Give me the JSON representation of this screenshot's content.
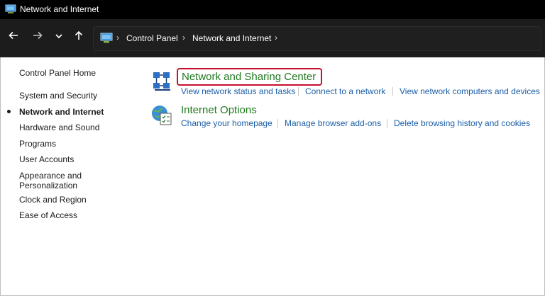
{
  "window": {
    "title": "Network and Internet"
  },
  "address_bar": {
    "breadcrumbs": [
      "Control Panel",
      "Network and Internet"
    ]
  },
  "sidebar": {
    "home": "Control Panel Home",
    "items": [
      {
        "label": "System and Security",
        "active": false
      },
      {
        "label": "Network and Internet",
        "active": true
      },
      {
        "label": "Hardware and Sound",
        "active": false
      },
      {
        "label": "Programs",
        "active": false
      },
      {
        "label": "User Accounts",
        "active": false
      },
      {
        "label": "Appearance and",
        "label2": "Personalization",
        "active": false
      },
      {
        "label": "Clock and Region",
        "active": false
      },
      {
        "label": "Ease of Access",
        "active": false
      }
    ]
  },
  "categories": [
    {
      "title": "Network and Sharing Center",
      "links": [
        "View network status and tasks",
        "Connect to a network",
        "View network computers and devices"
      ]
    },
    {
      "title": "Internet Options",
      "links": [
        "Change your homepage",
        "Manage browser add-ons",
        "Delete browsing history and cookies"
      ]
    }
  ],
  "colors": {
    "title_bar": "#000000",
    "address_bar": "#1c1c1c",
    "category_title": "#1f7a1f",
    "link": "#1a5ea8",
    "highlight": "#c8102e"
  },
  "icons": [
    "control-panel-icon",
    "back-arrow-icon",
    "forward-arrow-icon",
    "chevron-down-icon",
    "up-arrow-icon",
    "network-sharing-icon",
    "internet-options-icon"
  ]
}
